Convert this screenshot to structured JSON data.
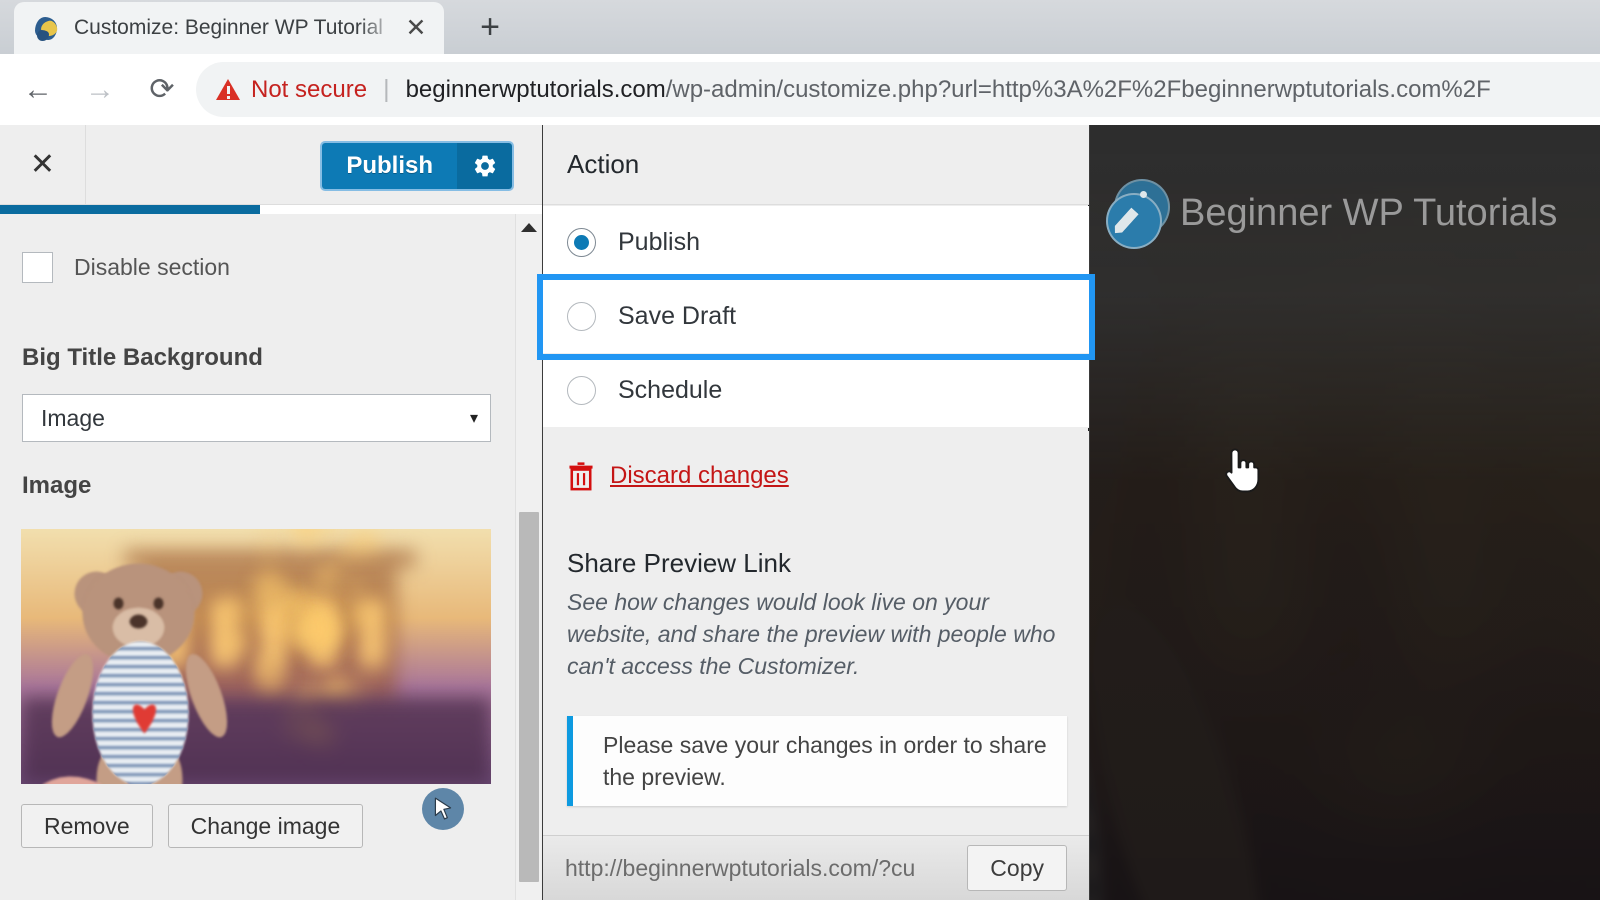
{
  "browser": {
    "tab": {
      "title": "Customize: Beginner WP Tutorial",
      "favicon_name": "wordpress-customizer-favicon",
      "close_label": "✕"
    },
    "new_tab_label": "+",
    "back_label": "←",
    "forward_label": "→",
    "reload_label": "⟳",
    "security_label": "Not secure",
    "url_host": "beginnerwptutorials.com",
    "url_path": "/wp-admin/customize.php?url=http%3A%2F%2Fbeginnerwptutorials.com%2F"
  },
  "customizer": {
    "close_label": "✕",
    "publish_label": "Publish",
    "gear_icon": "gear-icon",
    "progress_percent": 48,
    "disable_section_label": "Disable section",
    "big_title_background_label": "Big Title Background",
    "background_type_value": "Image",
    "background_type_caret": "▾",
    "image_label": "Image",
    "remove_label": "Remove",
    "change_image_label": "Change image"
  },
  "publish_settings": {
    "header_title": "Action",
    "options": [
      {
        "label": "Publish",
        "selected": true
      },
      {
        "label": "Save Draft",
        "selected": false,
        "focused": true
      },
      {
        "label": "Schedule",
        "selected": false
      }
    ],
    "discard_label": "Discard changes",
    "discard_icon": "trash-icon",
    "share_title": "Share Preview Link",
    "share_description": "See how changes would look live on your website, and share the preview with people who can't access the Customizer.",
    "notice_text": "Please save your changes in order to share the preview.",
    "share_url": "http://beginnerwptutorials.com/?cu",
    "copy_label": "Copy"
  },
  "preview": {
    "site_title": "Beginner WP Tutorials",
    "logo_icon": "pencil-circle-logo",
    "cursor_badge_icon": "cursor-pointer-icon"
  },
  "colors": {
    "accent_blue": "#0d7ab5",
    "focus_blue": "#2196f3",
    "danger_red": "#c41616",
    "notice_blue": "#0d9ae0",
    "panel_gray": "#eeeeee"
  }
}
